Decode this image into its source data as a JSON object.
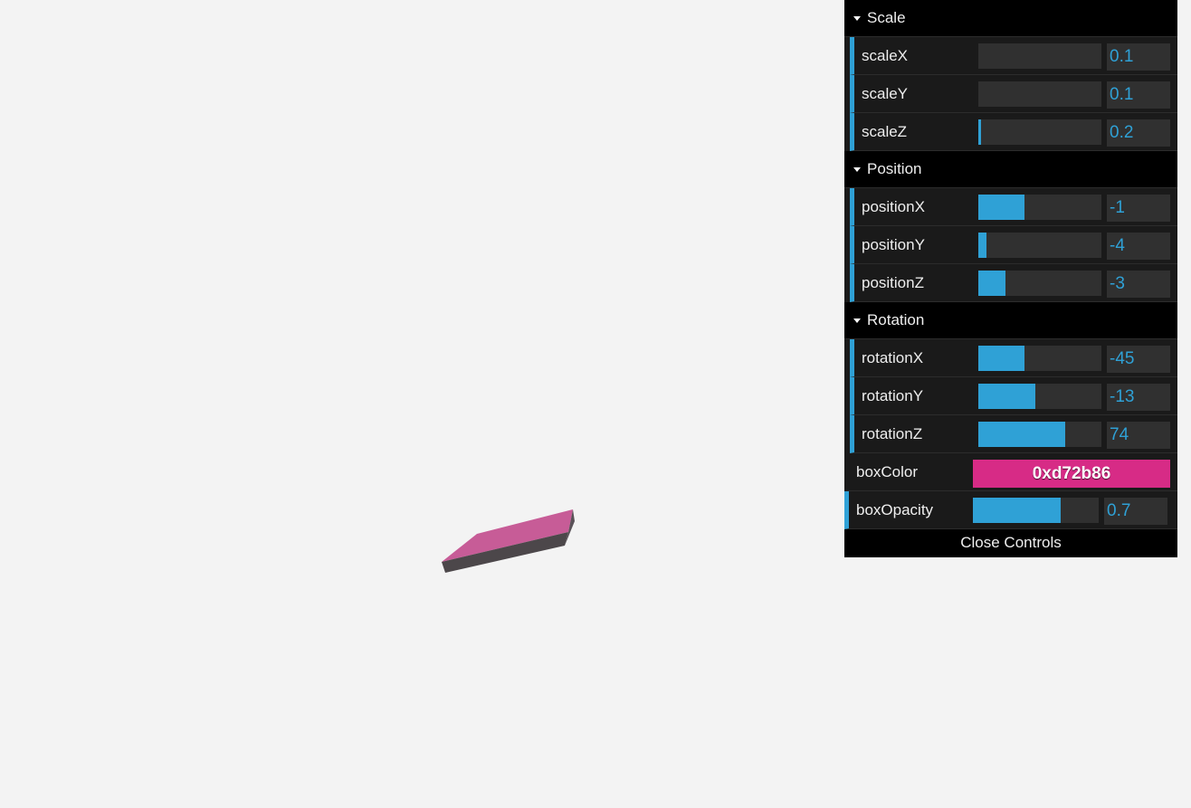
{
  "colors": {
    "background": "#f3f3f3",
    "accent": "#2fa1d6",
    "box_top": "#c75c97",
    "box_front": "#4c474a",
    "box_side": "#5a5258"
  },
  "gui": {
    "folders": [
      {
        "title": "Scale",
        "controllers": [
          {
            "label": "scaleX",
            "value": "0.1",
            "fraction": 0.0
          },
          {
            "label": "scaleY",
            "value": "0.1",
            "fraction": 0.0
          },
          {
            "label": "scaleZ",
            "value": "0.2",
            "fraction": 0.015
          }
        ]
      },
      {
        "title": "Position",
        "controllers": [
          {
            "label": "positionX",
            "value": "-1",
            "fraction": 0.375
          },
          {
            "label": "positionY",
            "value": "-4",
            "fraction": 0.065
          },
          {
            "label": "positionZ",
            "value": "-3",
            "fraction": 0.22
          }
        ]
      },
      {
        "title": "Rotation",
        "controllers": [
          {
            "label": "rotationX",
            "value": "-45",
            "fraction": 0.375
          },
          {
            "label": "rotationY",
            "value": "-13",
            "fraction": 0.465
          },
          {
            "label": "rotationZ",
            "value": "74",
            "fraction": 0.705
          }
        ]
      }
    ],
    "boxColor": {
      "label": "boxColor",
      "value": "0xd72b86",
      "hex": "#d72b86"
    },
    "boxOpacity": {
      "label": "boxOpacity",
      "value": "0.7",
      "fraction": 0.7
    },
    "close_label": "Close Controls"
  }
}
